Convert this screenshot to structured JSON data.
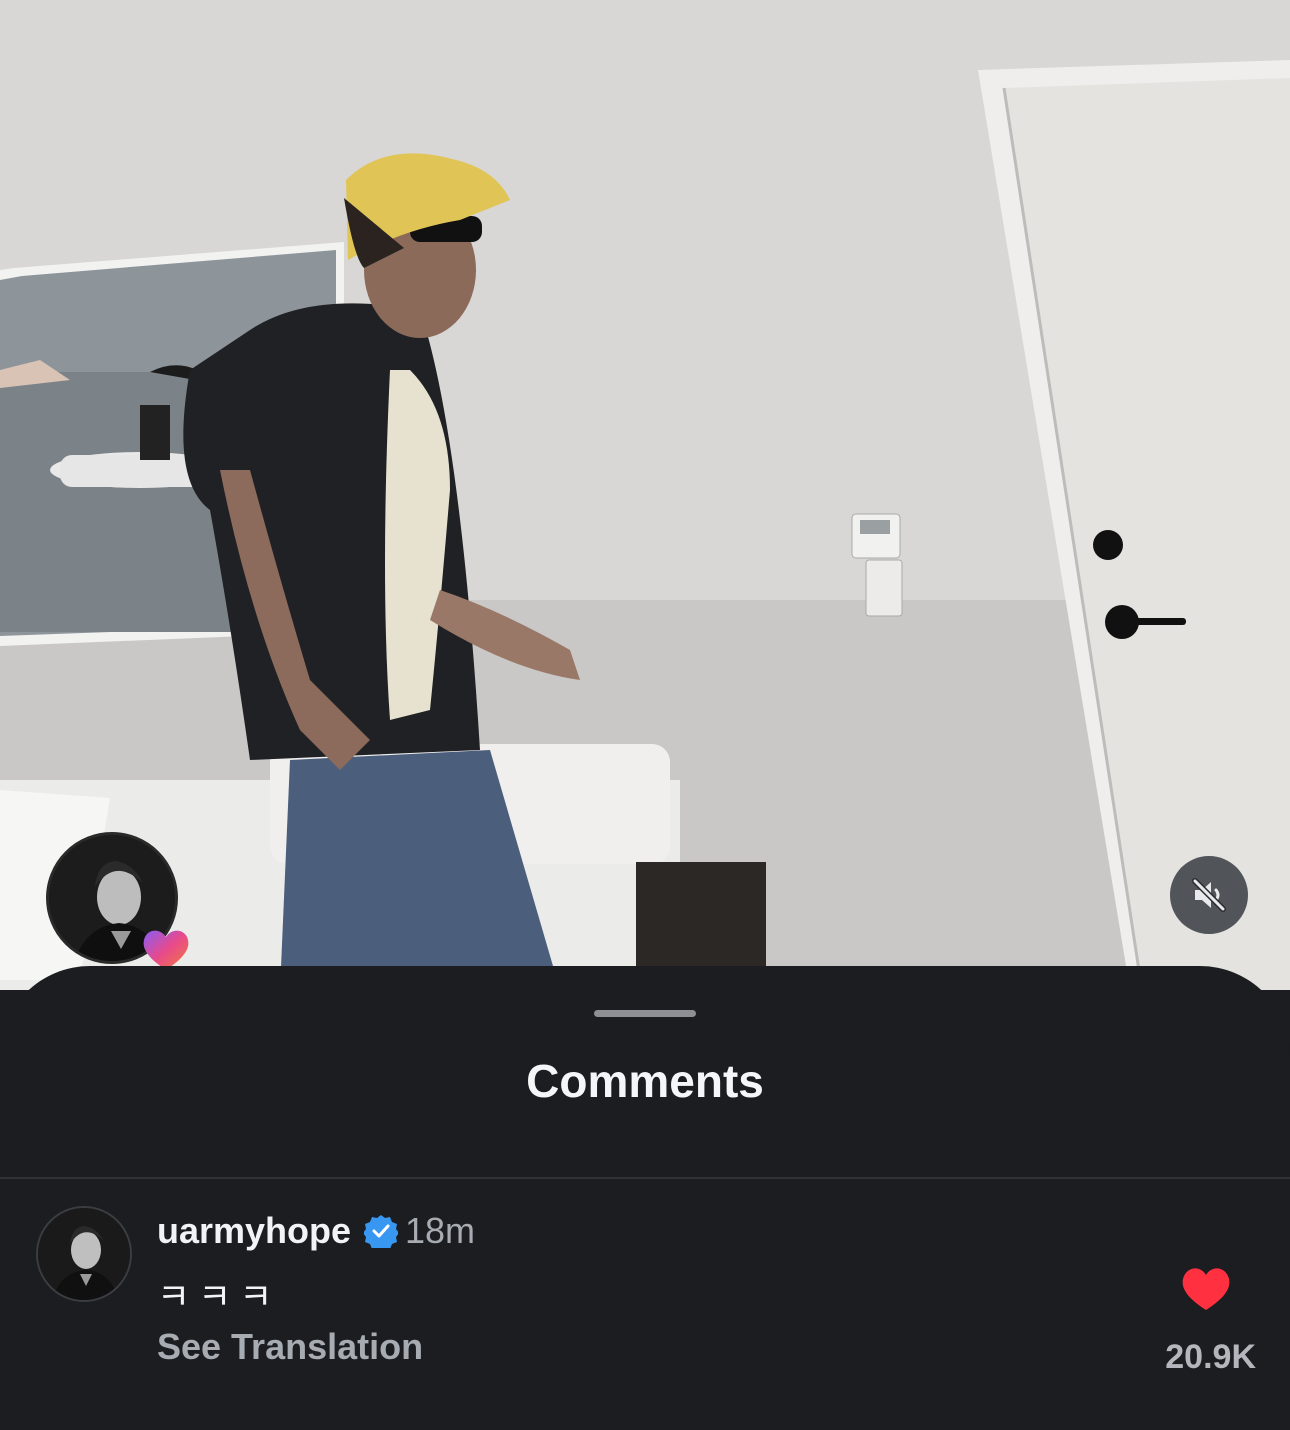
{
  "video": {
    "scene_description": "",
    "mute_icon": "speaker-muted-icon",
    "story_avatar_icon": "avatar",
    "heart_badge_icon": "heart-icon"
  },
  "sheet": {
    "title": "Comments"
  },
  "comments": [
    {
      "username": "uarmyhope",
      "verified_icon": "verified-badge-icon",
      "timestamp": "18m",
      "text": "ㅋㅋㅋ",
      "see_translation": "See Translation",
      "like_icon": "heart-icon",
      "liked": true,
      "like_count": "20.9K"
    }
  ],
  "colors": {
    "like_red": "#ff3040",
    "verified_blue": "#3897f0",
    "sheet_bg": "#1b1d20"
  }
}
